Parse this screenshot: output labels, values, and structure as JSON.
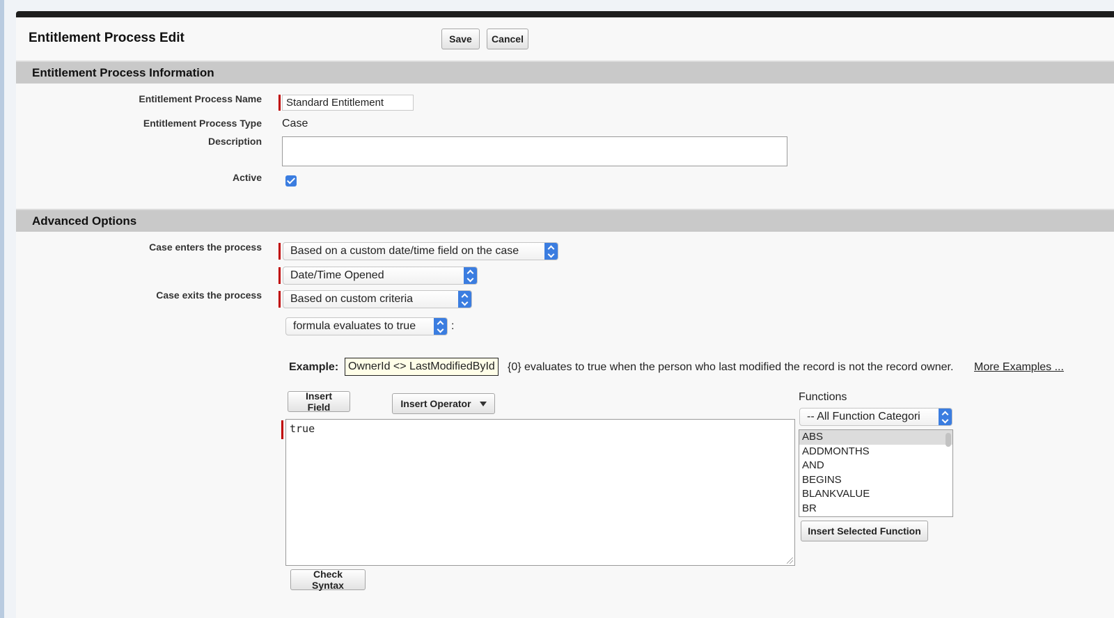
{
  "page": {
    "title": "Entitlement Process Edit",
    "save_label": "Save",
    "cancel_label": "Cancel"
  },
  "info_section": {
    "header": "Entitlement Process Information",
    "name_label": "Entitlement Process Name",
    "name_value": "Standard Entitlement",
    "type_label": "Entitlement Process Type",
    "type_value": "Case",
    "description_label": "Description",
    "description_value": "",
    "active_label": "Active",
    "active_checked": true
  },
  "advanced_section": {
    "header": "Advanced Options",
    "enters_label": "Case enters the process",
    "enters_value": "Based on a custom date/time field on the case",
    "enters_field_value": "Date/Time Opened",
    "exits_label": "Case exits the process",
    "exits_value": "Based on custom criteria",
    "criteria_value": "formula evaluates to true",
    "criteria_suffix": ":",
    "example_label": "Example:",
    "example_formula": "OwnerId <> LastModifiedById",
    "example_text": "{0} evaluates to true when the person who last modified the record is not the record owner.",
    "more_examples_label": "More Examples ...",
    "insert_field_label": "Insert Field",
    "insert_operator_label": "Insert Operator",
    "formula_value": "true",
    "functions_label": "Functions",
    "function_category_value": "-- All Function Categori",
    "functions_list": [
      "ABS",
      "ADDMONTHS",
      "AND",
      "BEGINS",
      "BLANKVALUE",
      "BR"
    ],
    "insert_function_label": "Insert Selected Function",
    "check_syntax_label": "Check Syntax"
  },
  "colors": {
    "accent": "#3b7de0",
    "required": "#c00000",
    "section_bar": "#c9c9c9",
    "top_bar": "#1d1d1d"
  }
}
